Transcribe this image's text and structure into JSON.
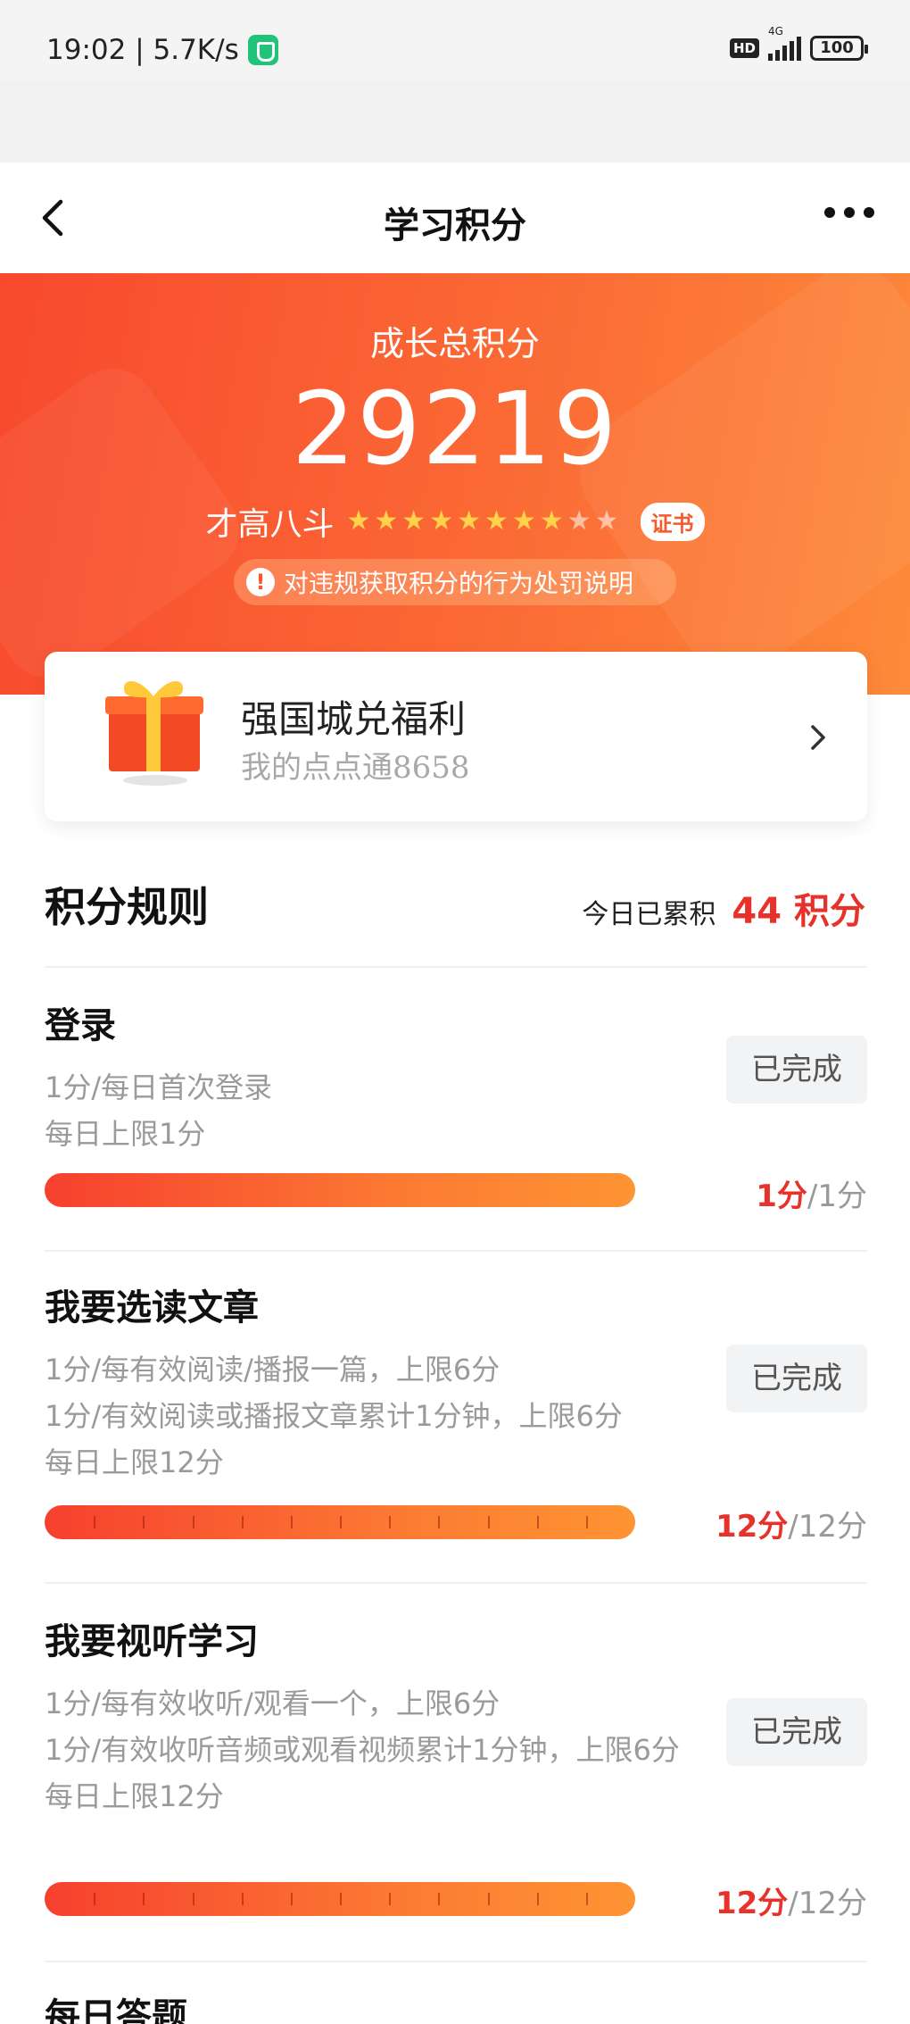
{
  "status_bar": {
    "time": "19:02 | 5.7K/s",
    "hd": "HD",
    "network": "4G",
    "battery": "100"
  },
  "nav": {
    "title": "学习积分"
  },
  "hero": {
    "label": "成长总积分",
    "total": "29219",
    "level_name": "才高八斗",
    "stars_total": 10,
    "stars_filled": 8,
    "cert_label": "证书",
    "notice": "对违规获取积分的行为处罚说明"
  },
  "welfare": {
    "title": "强国城兑福利",
    "subtitle": "我的点点通8658"
  },
  "rules": {
    "title": "积分规则",
    "today_label": "今日已累积",
    "today_value": "44 积分",
    "items": [
      {
        "title": "登录",
        "desc": [
          "1分/每日首次登录",
          "每日上限1分"
        ],
        "status": "已完成",
        "earned": "1分",
        "limit": "/1分",
        "progress": 1.0,
        "segments": 1
      },
      {
        "title": "我要选读文章",
        "desc": [
          "1分/每有效阅读/播报一篇，上限6分",
          "1分/有效阅读或播报文章累计1分钟，上限6分",
          "每日上限12分"
        ],
        "status": "已完成",
        "earned": "12分",
        "limit": "/12分",
        "progress": 1.0,
        "segments": 12
      },
      {
        "title": "我要视听学习",
        "desc": [
          "1分/每有效收听/观看一个，上限6分",
          "1分/有效收听音频或观看视频累计1分钟，上限6分",
          "每日上限12分"
        ],
        "status": "已完成",
        "earned": "12分",
        "limit": "/12分",
        "progress": 1.0,
        "segments": 12
      },
      {
        "title": "每日答题"
      }
    ]
  },
  "colors": {
    "accent": "#e7322b",
    "hero_start": "#f8492e",
    "hero_end": "#fd8a3a",
    "star": "#ffd24a"
  }
}
